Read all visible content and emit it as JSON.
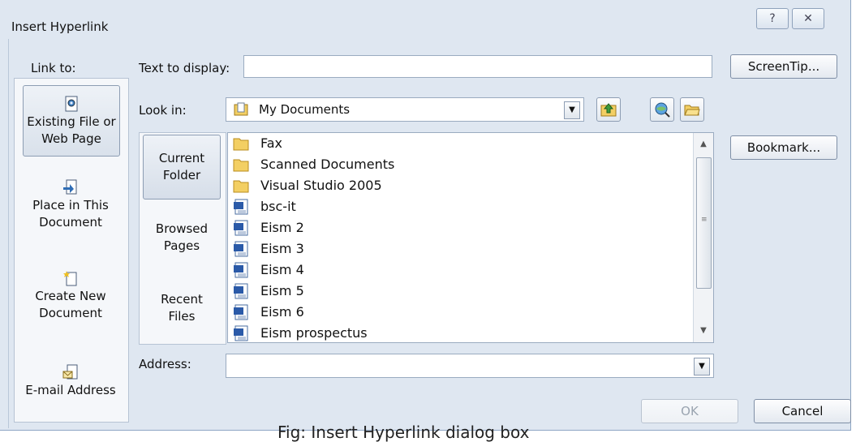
{
  "window": {
    "title": "Insert Hyperlink",
    "help_glyph": "?",
    "close_glyph": "✕"
  },
  "sidebar": {
    "heading": "Link to:",
    "items": [
      {
        "line1": "Existing File or",
        "line2": "Web Page",
        "icon": "existing-file-icon",
        "selected": true
      },
      {
        "line1": "Place in This",
        "line2": "Document",
        "icon": "place-in-document-icon",
        "selected": false
      },
      {
        "line1": "Create New",
        "line2": "Document",
        "icon": "create-new-document-icon",
        "selected": false
      },
      {
        "line1": "E-mail Address",
        "line2": "",
        "icon": "email-icon",
        "selected": false
      }
    ]
  },
  "text_to_display": {
    "label": "Text to display:",
    "value": ""
  },
  "screentip_button": "ScreenTip...",
  "look_in": {
    "label": "Look in:",
    "value": "My Documents"
  },
  "nav": {
    "items": [
      {
        "line1": "Current",
        "line2": "Folder",
        "selected": true
      },
      {
        "line1": "Browsed",
        "line2": "Pages",
        "selected": false
      },
      {
        "line1": "Recent",
        "line2": "Files",
        "selected": false
      }
    ]
  },
  "files": [
    {
      "name": "Fax",
      "type": "folder"
    },
    {
      "name": "Scanned Documents",
      "type": "folder"
    },
    {
      "name": "Visual Studio 2005",
      "type": "folder"
    },
    {
      "name": "bsc-it",
      "type": "word-doc"
    },
    {
      "name": "Eism 2",
      "type": "word-doc"
    },
    {
      "name": "Eism 3",
      "type": "word-doc"
    },
    {
      "name": "Eism 4",
      "type": "word-doc"
    },
    {
      "name": "Eism 5",
      "type": "word-doc"
    },
    {
      "name": "Eism 6",
      "type": "word-doc"
    },
    {
      "name": "Eism prospectus",
      "type": "word-doc"
    }
  ],
  "bookmark_button": "Bookmark...",
  "address": {
    "label": "Address:",
    "value": ""
  },
  "ok_button": "OK",
  "cancel_button": "Cancel",
  "caption": "Fig: Insert Hyperlink dialog box"
}
